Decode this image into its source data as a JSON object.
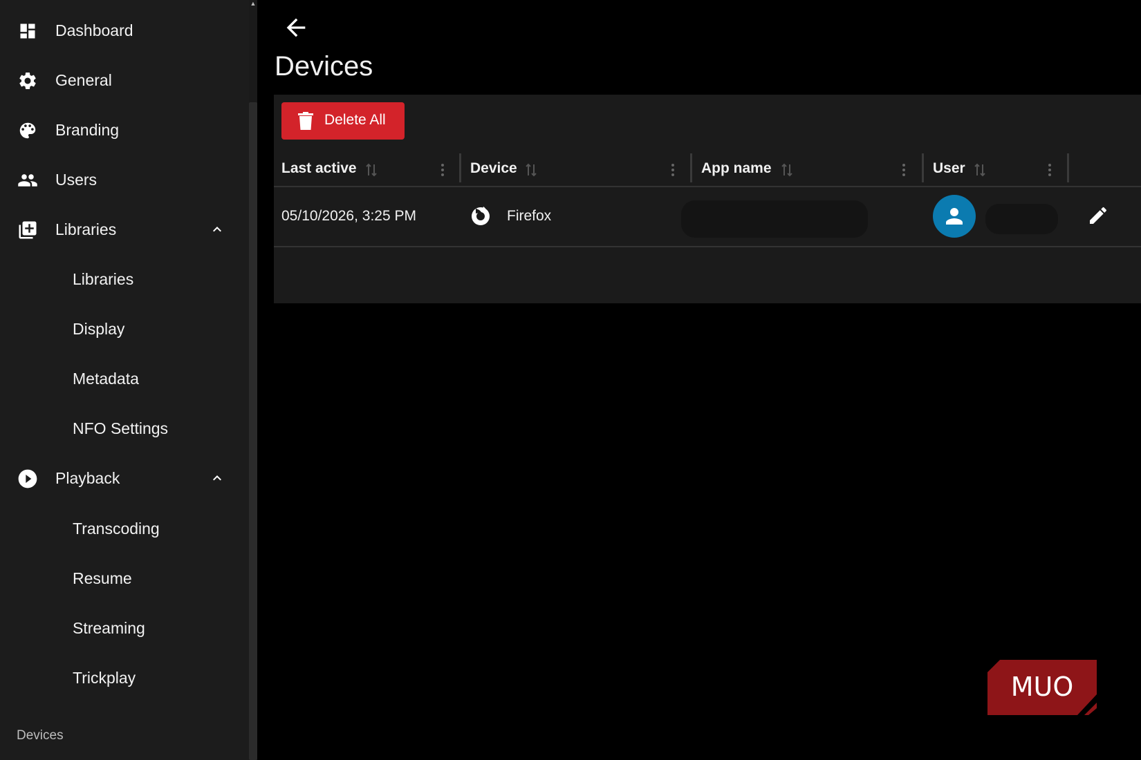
{
  "sidebar": {
    "items": [
      {
        "label": "Dashboard",
        "icon": "dashboard-icon"
      },
      {
        "label": "General",
        "icon": "gear-icon"
      },
      {
        "label": "Branding",
        "icon": "palette-icon"
      },
      {
        "label": "Users",
        "icon": "users-icon"
      },
      {
        "label": "Libraries",
        "icon": "library-add-icon",
        "expanded": true
      },
      {
        "label": "Libraries"
      },
      {
        "label": "Display"
      },
      {
        "label": "Metadata"
      },
      {
        "label": "NFO Settings"
      },
      {
        "label": "Playback",
        "icon": "play-circle-icon",
        "expanded": true
      },
      {
        "label": "Transcoding"
      },
      {
        "label": "Resume"
      },
      {
        "label": "Streaming"
      },
      {
        "label": "Trickplay"
      }
    ],
    "section_label": "Devices"
  },
  "main": {
    "title": "Devices",
    "delete_all_label": "Delete All",
    "table": {
      "columns": [
        "Last active",
        "Device",
        "App name",
        "User"
      ],
      "rows": [
        {
          "last_active": "05/10/2026, 3:25 PM",
          "device": "Firefox",
          "device_icon": "firefox-icon",
          "user_icon": "user-avatar-icon"
        }
      ]
    }
  },
  "logo": {
    "text": "MUO"
  },
  "colors": {
    "accent_red": "#d3232a",
    "avatar_blue": "#0b7bb0",
    "sidebar_bg": "#1c1c1c",
    "panel_bg": "#1b1b1b",
    "logo_red": "#8e1518"
  }
}
